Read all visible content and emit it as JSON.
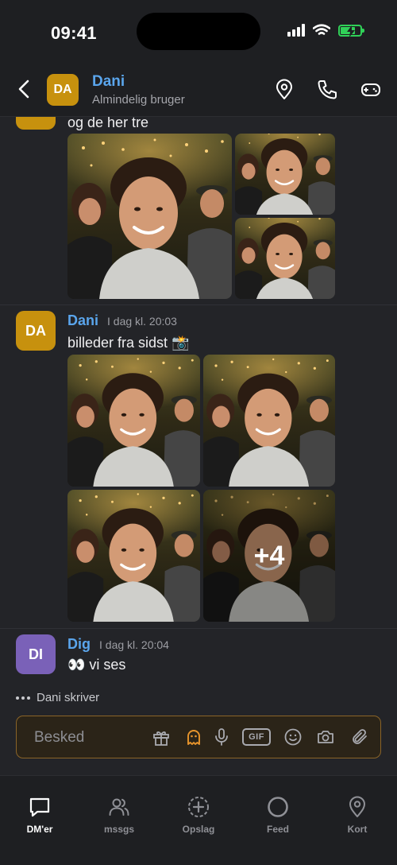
{
  "status_bar": {
    "time": "09:41"
  },
  "header": {
    "avatar_initials": "DA",
    "name": "Dani",
    "subtitle": "Almindelig bruger"
  },
  "messages": [
    {
      "text": "og de her tre",
      "avatar": "DA",
      "avatar_color": "#c7910e",
      "photo_count": 3
    },
    {
      "author": "Dani",
      "timestamp": "I dag kl. 20:03",
      "text": "billeder fra sidst 📸",
      "avatar": "DA",
      "avatar_color": "#c7910e",
      "photo_count": 4,
      "more_label": "+4"
    },
    {
      "author": "Dig",
      "timestamp": "I dag kl. 20:04",
      "text": "👀 vi ses",
      "avatar": "DI",
      "avatar_color": "#7a61b8"
    }
  ],
  "typing_indicator": "Dani skriver",
  "composer": {
    "placeholder": "Besked",
    "gif_label": "GIF",
    "accent_color": "#e8952c"
  },
  "tabbar": {
    "items": [
      {
        "label": "DM'er",
        "icon": "chat-bubble-icon",
        "active": true
      },
      {
        "label": "mssgs",
        "icon": "people-icon",
        "active": false
      },
      {
        "label": "Opslag",
        "icon": "add-circle-icon",
        "active": false
      },
      {
        "label": "Feed",
        "icon": "circle-icon",
        "active": false
      },
      {
        "label": "Kort",
        "icon": "map-pin-icon",
        "active": false
      }
    ]
  }
}
